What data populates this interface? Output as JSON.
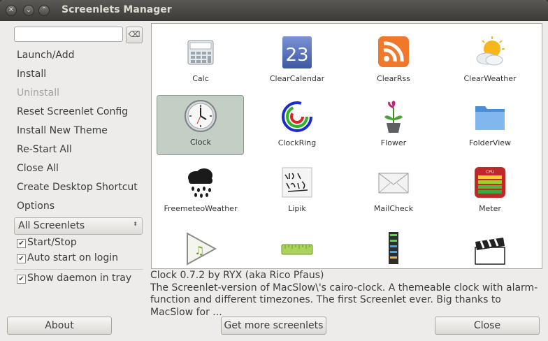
{
  "window": {
    "title": "Screenlets Manager"
  },
  "sidebar": {
    "search_value": "",
    "clear_icon": "clear-icon",
    "menu": [
      "Launch/Add",
      "Install",
      "Uninstall",
      "Reset Screenlet Config",
      "Install New Theme",
      "Re-Start All",
      "Close All",
      "Create Desktop Shortcut",
      "Options"
    ],
    "filter_selected": "All Screenlets",
    "checks": [
      {
        "label": "Start/Stop",
        "checked": true
      },
      {
        "label": "Auto start on login",
        "checked": true
      },
      {
        "label": "Show daemon in tray",
        "checked": true
      }
    ]
  },
  "screenlets": [
    {
      "name": "Calc",
      "icon": "calculator-icon"
    },
    {
      "name": "ClearCalendar",
      "icon": "calendar-icon",
      "badge": "23"
    },
    {
      "name": "ClearRss",
      "icon": "rss-icon"
    },
    {
      "name": "ClearWeather",
      "icon": "weather-icon"
    },
    {
      "name": "Clock",
      "icon": "clock-icon",
      "selected": true
    },
    {
      "name": "ClockRing",
      "icon": "clock-ring-icon"
    },
    {
      "name": "Flower",
      "icon": "flower-icon"
    },
    {
      "name": "FolderView",
      "icon": "folder-icon"
    },
    {
      "name": "FreemeteoWeather",
      "icon": "rain-cloud-icon"
    },
    {
      "name": "Lipik",
      "icon": "sketch-icon"
    },
    {
      "name": "MailCheck",
      "icon": "mail-icon"
    },
    {
      "name": "Meter",
      "icon": "meter-icon",
      "badge": "CPU"
    },
    {
      "name": "",
      "icon": "play-icon"
    },
    {
      "name": "",
      "icon": "ruler-icon"
    },
    {
      "name": "",
      "icon": "equalizer-icon"
    },
    {
      "name": "",
      "icon": "clapperboard-icon"
    }
  ],
  "description": {
    "line1": "Clock 0.7.2 by RYX (aka Rico Pfaus)",
    "line2": "The Screenlet-version of MacSlow\\'s cairo-clock. A themeable clock with alarm-",
    "line3": "function and different timezones. The first Screenlet ever. Big thanks to",
    "line4": "MacSlow for ..."
  },
  "buttons": {
    "about": "About",
    "get_more": "Get more screenlets",
    "close": "Close"
  }
}
